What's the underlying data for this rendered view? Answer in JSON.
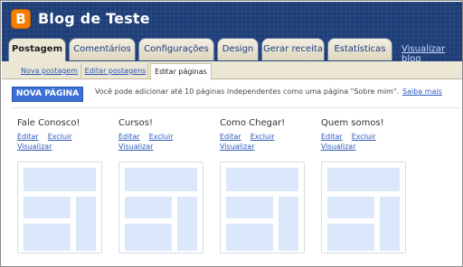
{
  "header": {
    "logo_letter": "B",
    "blog_title": "Blog de Teste",
    "view_blog": "Visualizar blog"
  },
  "tabs": [
    {
      "label": "Postagem",
      "active": true
    },
    {
      "label": "Comentários",
      "active": false
    },
    {
      "label": "Configurações",
      "active": false
    },
    {
      "label": "Design",
      "active": false
    },
    {
      "label": "Gerar receita",
      "active": false
    },
    {
      "label": "Estatísticas",
      "active": false
    }
  ],
  "subtabs": [
    {
      "label": "Nova postagem",
      "active": false
    },
    {
      "label": "Editar postagens",
      "active": false
    },
    {
      "label": "Editar páginas",
      "active": true
    }
  ],
  "actions": {
    "new_page_button": "NOVA PÁGINA",
    "info_text": "Você pode adicionar até 10 páginas independentes como uma página \"Sobre mim\".",
    "info_link": "Saiba mais"
  },
  "pages": [
    {
      "title": "Fale Conosco!",
      "edit": "Editar",
      "delete": "Excluir",
      "view": "Visualizar"
    },
    {
      "title": "Cursos!",
      "edit": "Editar",
      "delete": "Excluir",
      "view": "Visualizar"
    },
    {
      "title": "Como Chegar!",
      "edit": "Editar",
      "delete": "Excluir",
      "view": "Visualizar"
    },
    {
      "title": "Quem somos!",
      "edit": "Editar",
      "delete": "Excluir",
      "view": "Visualizar"
    }
  ]
}
